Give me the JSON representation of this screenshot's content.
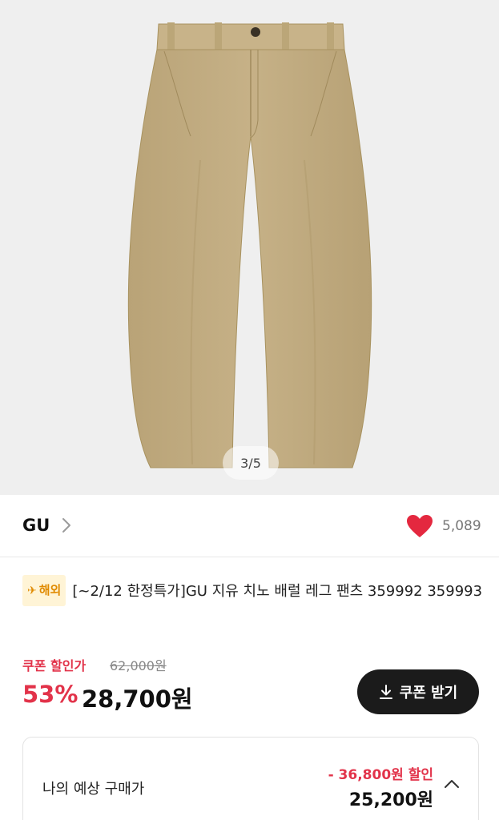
{
  "gallery": {
    "indicator": "3/5"
  },
  "brand": {
    "name": "GU",
    "likes": "5,089"
  },
  "product": {
    "badge": "해외",
    "title": "[~2/12 한정특가]GU 지유 치노 배럴 레그 팬츠 359992 359993"
  },
  "price": {
    "coupon_label": "쿠폰 할인가",
    "original": "62,000원",
    "discount_rate": "53%",
    "sale": "28,700원",
    "coupon_button": "쿠폰 받기"
  },
  "estimate": {
    "label": "나의 예상 구매가",
    "discount": "- 36,800원 할인",
    "price": "25,200원"
  },
  "colors": {
    "accent_red": "#e2334a",
    "button_dark": "#1b1b1b",
    "badge_bg": "#fff4d6",
    "badge_text": "#e08a00",
    "pants": "#c2ad82"
  },
  "icons": [
    "chevron-right-icon",
    "heart-icon",
    "airplane-icon",
    "download-icon",
    "chevron-up-icon"
  ]
}
